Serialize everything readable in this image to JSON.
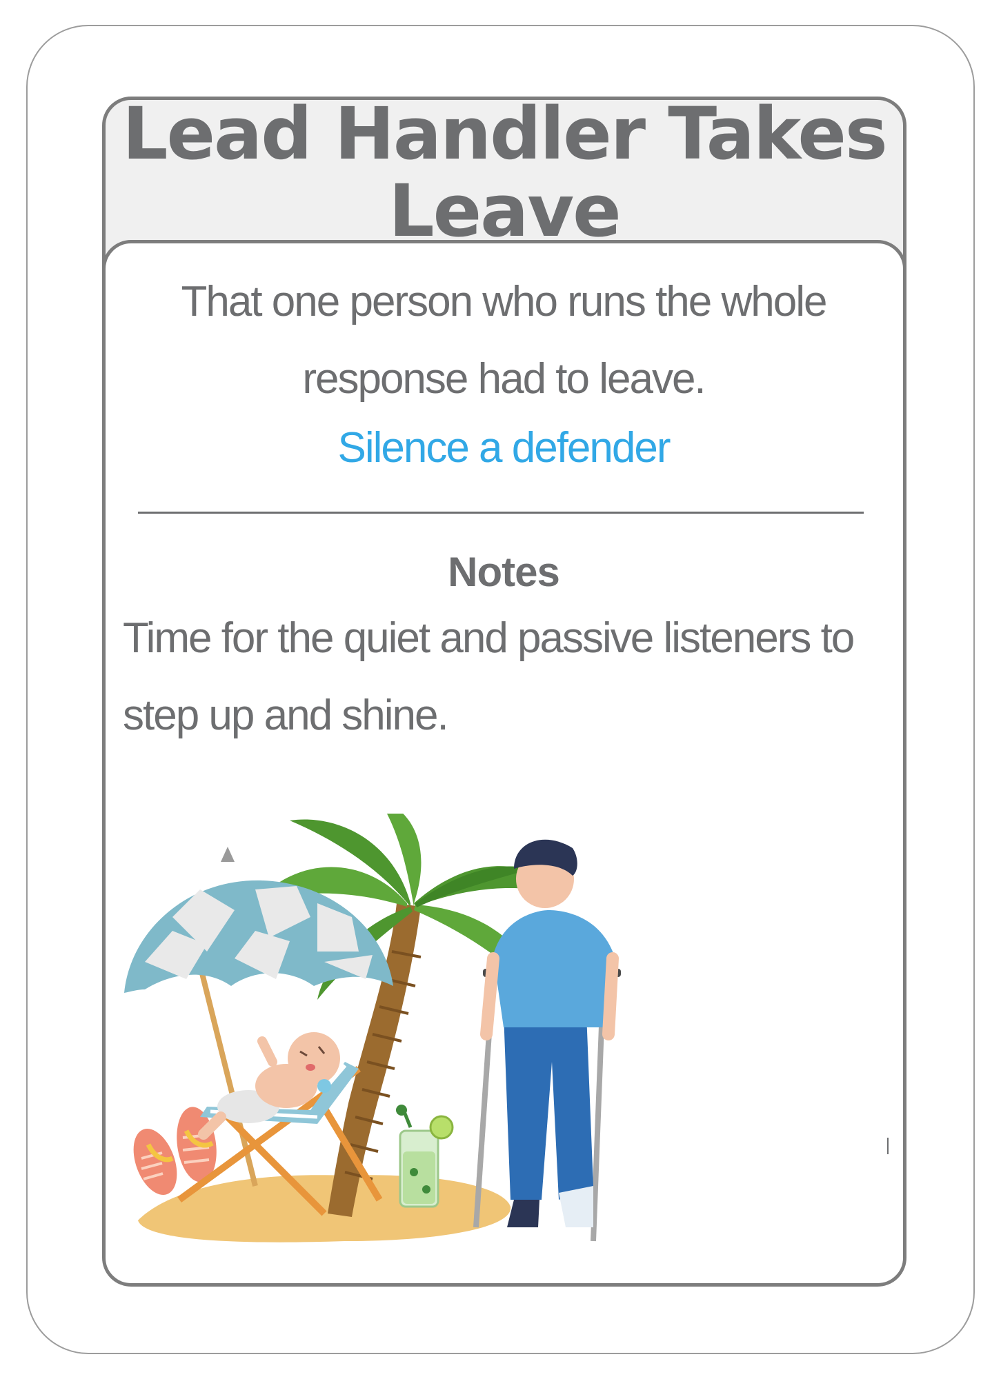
{
  "card": {
    "title": "Lead Handler Takes Leave",
    "description": "That one person who runs the whole response had to leave.",
    "effect": "Silence a defender",
    "notes_heading": "Notes",
    "notes_text": "Time for the quiet and passive listeners to step up and shine."
  },
  "colors": {
    "text_gray": "#6d6e70",
    "effect_blue": "#31a8e6",
    "border_gray": "#7d7d7d",
    "title_panel_bg": "#f0f0f0"
  },
  "illustration": {
    "icons": [
      "beach-umbrella-icon",
      "flip-flops-icon",
      "palm-tree-icon",
      "deck-chair-icon",
      "crying-baby-icon",
      "mojito-glass-icon",
      "man-on-crutches-icon",
      "sand-patch-icon"
    ]
  }
}
